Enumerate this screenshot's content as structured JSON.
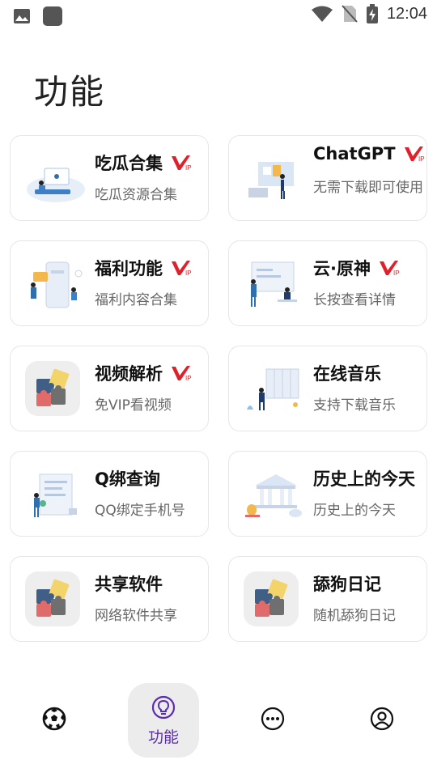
{
  "status_bar": {
    "time": "12:04"
  },
  "page": {
    "title": "功能"
  },
  "cards": [
    {
      "title": "吃瓜合集",
      "subtitle": "吃瓜资源合集",
      "vip": true
    },
    {
      "title": "ChatGPT",
      "subtitle": "无需下载即可使用",
      "vip": true
    },
    {
      "title": "福利功能",
      "subtitle": "福利内容合集",
      "vip": true
    },
    {
      "title": "云·原神",
      "subtitle": "长按查看详情",
      "vip": true
    },
    {
      "title": "视频解析",
      "subtitle": "免VIP看视频",
      "vip": true
    },
    {
      "title": "在线音乐",
      "subtitle": "支持下载音乐",
      "vip": false
    },
    {
      "title": "Q绑查询",
      "subtitle": "QQ绑定手机号",
      "vip": false
    },
    {
      "title": "历史上的今天",
      "subtitle": "历史上的今天",
      "vip": false
    },
    {
      "title": "共享软件",
      "subtitle": "网络软件共享",
      "vip": false
    },
    {
      "title": "舔狗日记",
      "subtitle": "随机舔狗日记",
      "vip": false
    }
  ],
  "vip_badge": {
    "mark": "V",
    "small": "IP",
    "color": "#e0202a"
  },
  "bottom_nav": {
    "items": [
      {
        "icon": "soccer-ball-icon"
      },
      {
        "icon": "lightbulb-icon",
        "label": "功能",
        "active": true
      },
      {
        "icon": "more-dots-icon"
      },
      {
        "icon": "user-profile-icon"
      }
    ],
    "active_color": "#5b2db0"
  }
}
